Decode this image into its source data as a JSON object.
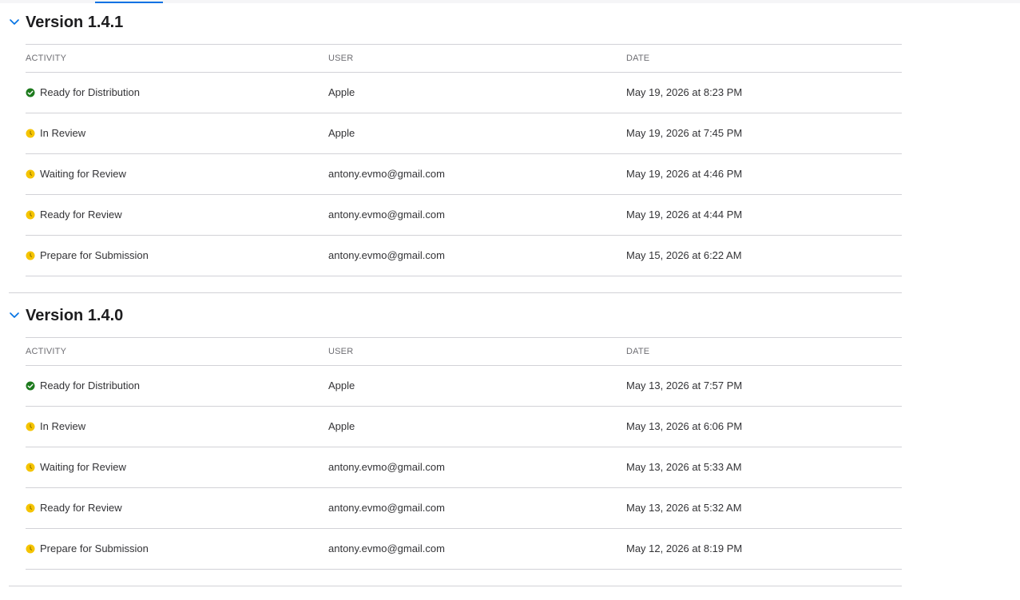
{
  "versions": [
    {
      "title": "Version 1.4.1",
      "columns": {
        "activity": "ACTIVITY",
        "user": "USER",
        "date": "DATE"
      },
      "rows": [
        {
          "status": "complete",
          "activity": "Ready for Distribution",
          "user": "Apple",
          "date": "May 19, 2026 at 8:23 PM"
        },
        {
          "status": "pending",
          "activity": "In Review",
          "user": "Apple",
          "date": "May 19, 2026 at 7:45 PM"
        },
        {
          "status": "pending",
          "activity": "Waiting for Review",
          "user": "antony.evmo@gmail.com",
          "date": "May 19, 2026 at 4:46 PM"
        },
        {
          "status": "pending",
          "activity": "Ready for Review",
          "user": "antony.evmo@gmail.com",
          "date": "May 19, 2026 at 4:44 PM"
        },
        {
          "status": "pending",
          "activity": "Prepare for Submission",
          "user": "antony.evmo@gmail.com",
          "date": "May 15, 2026 at 6:22 AM"
        }
      ]
    },
    {
      "title": "Version 1.4.0",
      "columns": {
        "activity": "ACTIVITY",
        "user": "USER",
        "date": "DATE"
      },
      "rows": [
        {
          "status": "complete",
          "activity": "Ready for Distribution",
          "user": "Apple",
          "date": "May 13, 2026 at 7:57 PM"
        },
        {
          "status": "pending",
          "activity": "In Review",
          "user": "Apple",
          "date": "May 13, 2026 at 6:06 PM"
        },
        {
          "status": "pending",
          "activity": "Waiting for Review",
          "user": "antony.evmo@gmail.com",
          "date": "May 13, 2026 at 5:33 AM"
        },
        {
          "status": "pending",
          "activity": "Ready for Review",
          "user": "antony.evmo@gmail.com",
          "date": "May 13, 2026 at 5:32 AM"
        },
        {
          "status": "pending",
          "activity": "Prepare for Submission",
          "user": "antony.evmo@gmail.com",
          "date": "May 12, 2026 at 8:19 PM"
        }
      ]
    }
  ],
  "colors": {
    "accent": "#0071e3",
    "status_complete": "#1d7a1d",
    "status_pending": "#f5c400"
  },
  "icons": {
    "collapse": "chevron-down-icon",
    "complete": "check-circle-icon",
    "pending": "clock-circle-icon"
  }
}
